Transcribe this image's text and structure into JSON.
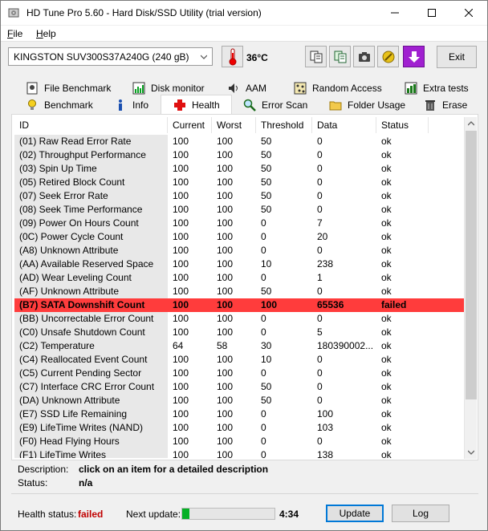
{
  "window": {
    "title": "HD Tune Pro 5.60 - Hard Disk/SSD Utility (trial version)",
    "min_glyph": "—",
    "max_glyph": "☐",
    "close_glyph": "✕"
  },
  "menu": {
    "file": {
      "u": "F",
      "rest": "ile"
    },
    "help": {
      "u": "H",
      "rest": "elp"
    }
  },
  "toolbar": {
    "drive": "KINGSTON SUV300S37A240G (240 gB)",
    "temperature": "36°C",
    "exit_label": "Exit"
  },
  "tabs": {
    "row1": [
      "File Benchmark",
      "Disk monitor",
      "AAM",
      "Random Access",
      "Extra tests"
    ],
    "row2": [
      "Benchmark",
      "Info",
      "Health",
      "Error Scan",
      "Folder Usage",
      "Erase"
    ],
    "active": "Health"
  },
  "table": {
    "columns": [
      "ID",
      "Current",
      "Worst",
      "Threshold",
      "Data",
      "Status"
    ],
    "rows": [
      {
        "id": "(01) Raw Read Error Rate",
        "current": "100",
        "worst": "100",
        "threshold": "50",
        "data": "0",
        "status": "ok"
      },
      {
        "id": "(02) Throughput Performance",
        "current": "100",
        "worst": "100",
        "threshold": "50",
        "data": "0",
        "status": "ok"
      },
      {
        "id": "(03) Spin Up Time",
        "current": "100",
        "worst": "100",
        "threshold": "50",
        "data": "0",
        "status": "ok"
      },
      {
        "id": "(05) Retired Block Count",
        "current": "100",
        "worst": "100",
        "threshold": "50",
        "data": "0",
        "status": "ok"
      },
      {
        "id": "(07) Seek Error Rate",
        "current": "100",
        "worst": "100",
        "threshold": "50",
        "data": "0",
        "status": "ok"
      },
      {
        "id": "(08) Seek Time Performance",
        "current": "100",
        "worst": "100",
        "threshold": "50",
        "data": "0",
        "status": "ok"
      },
      {
        "id": "(09) Power On Hours Count",
        "current": "100",
        "worst": "100",
        "threshold": "0",
        "data": "7",
        "status": "ok"
      },
      {
        "id": "(0C) Power Cycle Count",
        "current": "100",
        "worst": "100",
        "threshold": "0",
        "data": "20",
        "status": "ok"
      },
      {
        "id": "(A8) Unknown Attribute",
        "current": "100",
        "worst": "100",
        "threshold": "0",
        "data": "0",
        "status": "ok"
      },
      {
        "id": "(AA) Available Reserved Space",
        "current": "100",
        "worst": "100",
        "threshold": "10",
        "data": "238",
        "status": "ok"
      },
      {
        "id": "(AD) Wear Leveling Count",
        "current": "100",
        "worst": "100",
        "threshold": "0",
        "data": "1",
        "status": "ok"
      },
      {
        "id": "(AF) Unknown Attribute",
        "current": "100",
        "worst": "100",
        "threshold": "50",
        "data": "0",
        "status": "ok"
      },
      {
        "id": "(B7) SATA Downshift Count",
        "current": "100",
        "worst": "100",
        "threshold": "100",
        "data": "65536",
        "status": "failed"
      },
      {
        "id": "(BB) Uncorrectable Error Count",
        "current": "100",
        "worst": "100",
        "threshold": "0",
        "data": "0",
        "status": "ok"
      },
      {
        "id": "(C0) Unsafe Shutdown Count",
        "current": "100",
        "worst": "100",
        "threshold": "0",
        "data": "5",
        "status": "ok"
      },
      {
        "id": "(C2) Temperature",
        "current": "64",
        "worst": "58",
        "threshold": "30",
        "data": "180390002...",
        "status": "ok"
      },
      {
        "id": "(C4) Reallocated Event Count",
        "current": "100",
        "worst": "100",
        "threshold": "10",
        "data": "0",
        "status": "ok"
      },
      {
        "id": "(C5) Current Pending Sector",
        "current": "100",
        "worst": "100",
        "threshold": "0",
        "data": "0",
        "status": "ok"
      },
      {
        "id": "(C7) Interface CRC Error Count",
        "current": "100",
        "worst": "100",
        "threshold": "50",
        "data": "0",
        "status": "ok"
      },
      {
        "id": "(DA) Unknown Attribute",
        "current": "100",
        "worst": "100",
        "threshold": "50",
        "data": "0",
        "status": "ok"
      },
      {
        "id": "(E7) SSD Life Remaining",
        "current": "100",
        "worst": "100",
        "threshold": "0",
        "data": "100",
        "status": "ok"
      },
      {
        "id": "(E9) LifeTime Writes (NAND)",
        "current": "100",
        "worst": "100",
        "threshold": "0",
        "data": "103",
        "status": "ok"
      },
      {
        "id": "(F0) Head Flying Hours",
        "current": "100",
        "worst": "100",
        "threshold": "0",
        "data": "0",
        "status": "ok"
      },
      {
        "id": "(F1) LifeTime Writes",
        "current": "100",
        "worst": "100",
        "threshold": "0",
        "data": "138",
        "status": "ok"
      }
    ]
  },
  "description": {
    "label": "Description:",
    "value": "click on an item for a detailed description",
    "status_label": "Status:",
    "status_value": "n/a"
  },
  "statusbar": {
    "health_label": "Health status:",
    "health_value": "failed",
    "next_update_label": "Next update:",
    "progress_fraction": 0.08,
    "next_update_time": "4:34",
    "update_button": "Update",
    "log_button": "Log"
  },
  "colors": {
    "failed_row": "#ff3c3c",
    "failed_text": "#c00000",
    "progress": "#06b025",
    "accent": "#0078d7"
  }
}
